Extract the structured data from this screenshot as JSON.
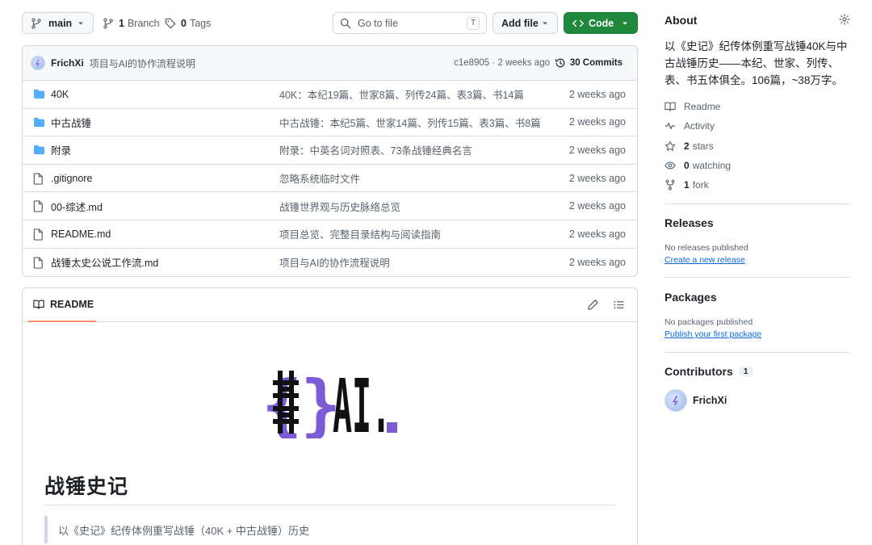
{
  "toolbar": {
    "branch_label": "main",
    "branches_count": "1",
    "branches_label": "Branch",
    "tags_count": "0",
    "tags_label": "Tags",
    "search_placeholder": "Go to file",
    "search_shortcut": "T",
    "add_file_label": "Add file",
    "code_label": "Code"
  },
  "commit": {
    "author": "FrichXi",
    "message": "项目与AI的协作流程说明",
    "hash_time": "c1e8905 · 2 weeks ago",
    "commits_label": "30 Commits"
  },
  "files": [
    {
      "type": "folder",
      "name": "40K",
      "message": "40K：本纪19篇、世家8篇、列传24篇、表3篇、书14篇",
      "date": "2 weeks ago"
    },
    {
      "type": "folder",
      "name": "中古战锤",
      "message": "中古战锤：本纪5篇、世家14篇、列传15篇、表3篇、书8篇",
      "date": "2 weeks ago"
    },
    {
      "type": "folder",
      "name": "附录",
      "message": "附录：中英名词对照表、73条战锤经典名言",
      "date": "2 weeks ago"
    },
    {
      "type": "file",
      "name": ".gitignore",
      "message": "忽略系统临时文件",
      "date": "2 weeks ago"
    },
    {
      "type": "file",
      "name": "00-综述.md",
      "message": "战锤世界观与历史脉络总览",
      "date": "2 weeks ago"
    },
    {
      "type": "file",
      "name": "README.md",
      "message": "项目总览、完整目录结构与阅读指南",
      "date": "2 weeks ago"
    },
    {
      "type": "file",
      "name": "战锤太史公说工作流.md",
      "message": "项目与AI的协作流程说明",
      "date": "2 weeks ago"
    }
  ],
  "readme": {
    "tab_label": "README",
    "heading": "战锤史记",
    "quote": "以《史记》纪传体例重写战锤（40K + 中古战锤）历史",
    "logo_text_bracket_left": "{",
    "logo_text_bracket_right": "}",
    "logo_text_ai": "AI."
  },
  "about": {
    "title": "About",
    "description": "以《史记》纪传体例重写战锤40K与中古战锤历史——本纪、世家、列传、表、书五体俱全。106篇，~38万字。",
    "readme_label": "Readme",
    "activity_label": "Activity",
    "stars_count": "2",
    "stars_label": "stars",
    "watching_count": "0",
    "watching_label": "watching",
    "forks_count": "1",
    "forks_label": "fork"
  },
  "releases": {
    "title": "Releases",
    "empty_text": "No releases published",
    "create_link": "Create a new release"
  },
  "packages": {
    "title": "Packages",
    "empty_text": "No packages published",
    "publish_link": "Publish your first package"
  },
  "contributors": {
    "title": "Contributors",
    "count": "1",
    "items": [
      {
        "name": "FrichXi"
      }
    ]
  },
  "colors": {
    "accent_green": "#1f883d",
    "link_blue": "#0969da",
    "folder_blue": "#54aeff",
    "tab_underline": "#fd8c73",
    "logo_purple": "#7b5cd6"
  }
}
